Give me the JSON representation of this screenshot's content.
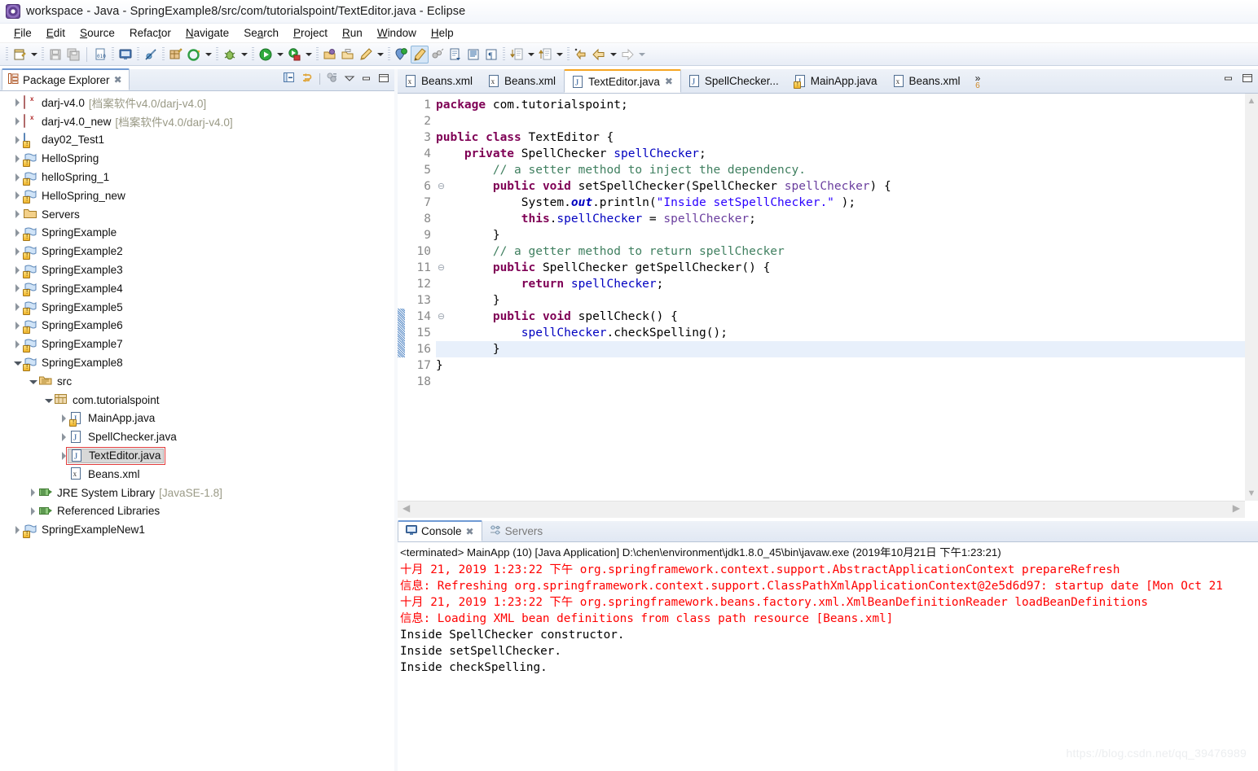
{
  "window": {
    "title": "workspace - Java - SpringExample8/src/com/tutorialspoint/TextEditor.java - Eclipse",
    "app_icon": "eclipse-icon"
  },
  "menubar": [
    {
      "label": "File"
    },
    {
      "label": "Edit"
    },
    {
      "label": "Source"
    },
    {
      "label": "Refactor"
    },
    {
      "label": "Navigate"
    },
    {
      "label": "Search"
    },
    {
      "label": "Project"
    },
    {
      "label": "Run"
    },
    {
      "label": "Window"
    },
    {
      "label": "Help"
    }
  ],
  "toolbar": {
    "items": [
      {
        "name": "new-wizard-icon",
        "kind": "icon"
      },
      {
        "name": "new-wizard-dropdown",
        "kind": "arrow"
      },
      {
        "name": "save-icon",
        "kind": "icon"
      },
      {
        "name": "save-all-icon",
        "kind": "icon"
      },
      {
        "name": "separator",
        "kind": "sep"
      },
      {
        "name": "toggle-hex-icon",
        "kind": "icon"
      },
      {
        "name": "open-console-icon",
        "kind": "icon"
      },
      {
        "name": "skip-breakpoints-icon",
        "kind": "icon"
      },
      {
        "name": "new-java-package-icon",
        "kind": "icon"
      },
      {
        "name": "external-tools-icon",
        "kind": "icon"
      },
      {
        "name": "external-tools-dropdown",
        "kind": "arrow"
      },
      {
        "name": "debug-icon",
        "kind": "icon"
      },
      {
        "name": "debug-dropdown",
        "kind": "arrow"
      },
      {
        "name": "run-icon",
        "kind": "icon"
      },
      {
        "name": "run-dropdown",
        "kind": "arrow"
      },
      {
        "name": "run-as-server-icon",
        "kind": "icon"
      },
      {
        "name": "run-as-server-dropdown",
        "kind": "arrow"
      },
      {
        "name": "open-type-icon",
        "kind": "icon"
      },
      {
        "name": "open-task-icon",
        "kind": "icon"
      },
      {
        "name": "new-annotation-icon",
        "kind": "icon"
      },
      {
        "name": "new-annotation-dropdown",
        "kind": "arrow"
      },
      {
        "name": "search-icon",
        "kind": "icon"
      },
      {
        "name": "mark-occurrences-icon",
        "kind": "icon",
        "selected": true
      },
      {
        "name": "link-icon",
        "kind": "icon"
      },
      {
        "name": "next-edit-icon",
        "kind": "icon"
      },
      {
        "name": "show-whitespace-icon",
        "kind": "icon"
      },
      {
        "name": "pilcrow-icon",
        "kind": "icon"
      },
      {
        "name": "next-annotation-icon",
        "kind": "icon"
      },
      {
        "name": "next-annotation-dropdown",
        "kind": "arrow"
      },
      {
        "name": "previous-annotation-icon",
        "kind": "icon"
      },
      {
        "name": "previous-annotation-dropdown",
        "kind": "arrow"
      },
      {
        "name": "last-edit-location-icon",
        "kind": "icon"
      },
      {
        "name": "back-icon",
        "kind": "icon"
      },
      {
        "name": "back-dropdown",
        "kind": "arrow"
      },
      {
        "name": "forward-icon",
        "kind": "icon"
      },
      {
        "name": "forward-dropdown",
        "kind": "arrow"
      }
    ]
  },
  "package_explorer": {
    "tab_label": "Package Explorer",
    "view_icons": [
      "collapse-all-icon",
      "link-with-editor-icon",
      "view-menu-icon",
      "minimize-icon",
      "maximize-icon"
    ],
    "tree": [
      {
        "label": "darj-v4.0",
        "suffix": "[档案软件v4.0/darj-v4.0]",
        "indent": 0,
        "twisty": "collapsed",
        "icon": "darj-project-icon"
      },
      {
        "label": "darj-v4.0_new",
        "suffix": "[档案软件v4.0/darj-v4.0]",
        "indent": 0,
        "twisty": "collapsed",
        "icon": "darj-project-icon"
      },
      {
        "label": "day02_Test1",
        "suffix": "",
        "indent": 0,
        "twisty": "collapsed",
        "icon": "web-project-icon"
      },
      {
        "label": "HelloSpring",
        "suffix": "",
        "indent": 0,
        "twisty": "collapsed",
        "icon": "java-project-icon"
      },
      {
        "label": "helloSpring_1",
        "suffix": "",
        "indent": 0,
        "twisty": "collapsed",
        "icon": "java-project-icon"
      },
      {
        "label": "HelloSpring_new",
        "suffix": "",
        "indent": 0,
        "twisty": "collapsed",
        "icon": "java-project-icon"
      },
      {
        "label": "Servers",
        "suffix": "",
        "indent": 0,
        "twisty": "collapsed",
        "icon": "folder-icon"
      },
      {
        "label": "SpringExample",
        "suffix": "",
        "indent": 0,
        "twisty": "collapsed",
        "icon": "java-project-icon"
      },
      {
        "label": "SpringExample2",
        "suffix": "",
        "indent": 0,
        "twisty": "collapsed",
        "icon": "java-project-icon"
      },
      {
        "label": "SpringExample3",
        "suffix": "",
        "indent": 0,
        "twisty": "collapsed",
        "icon": "java-project-icon"
      },
      {
        "label": "SpringExample4",
        "suffix": "",
        "indent": 0,
        "twisty": "collapsed",
        "icon": "java-project-icon"
      },
      {
        "label": "SpringExample5",
        "suffix": "",
        "indent": 0,
        "twisty": "collapsed",
        "icon": "java-project-icon"
      },
      {
        "label": "SpringExample6",
        "suffix": "",
        "indent": 0,
        "twisty": "collapsed",
        "icon": "java-project-icon"
      },
      {
        "label": "SpringExample7",
        "suffix": "",
        "indent": 0,
        "twisty": "collapsed",
        "icon": "java-project-icon"
      },
      {
        "label": "SpringExample8",
        "suffix": "",
        "indent": 0,
        "twisty": "expanded",
        "icon": "java-project-icon"
      },
      {
        "label": "src",
        "suffix": "",
        "indent": 1,
        "twisty": "expanded",
        "icon": "source-folder-icon"
      },
      {
        "label": "com.tutorialspoint",
        "suffix": "",
        "indent": 2,
        "twisty": "expanded",
        "icon": "package-icon"
      },
      {
        "label": "MainApp.java",
        "suffix": "",
        "indent": 3,
        "twisty": "collapsed",
        "icon": "java-file-warning-icon"
      },
      {
        "label": "SpellChecker.java",
        "suffix": "",
        "indent": 3,
        "twisty": "collapsed",
        "icon": "java-file-icon"
      },
      {
        "label": "TextEditor.java",
        "suffix": "",
        "indent": 3,
        "twisty": "collapsed",
        "icon": "java-file-icon",
        "selected": true,
        "highlight_box": true
      },
      {
        "label": "Beans.xml",
        "suffix": "",
        "indent": 3,
        "twisty": "none",
        "icon": "xml-file-icon"
      },
      {
        "label": "JRE System Library",
        "suffix": "[JavaSE-1.8]",
        "indent": 1,
        "twisty": "collapsed",
        "icon": "library-icon"
      },
      {
        "label": "Referenced Libraries",
        "suffix": "",
        "indent": 1,
        "twisty": "collapsed",
        "icon": "library-icon"
      },
      {
        "label": "SpringExampleNew1",
        "suffix": "",
        "indent": 0,
        "twisty": "collapsed",
        "icon": "java-project-icon"
      }
    ]
  },
  "editor": {
    "tabs": [
      {
        "label": "Beans.xml",
        "icon": "xml-file-icon",
        "active": false
      },
      {
        "label": "Beans.xml",
        "icon": "xml-file-icon",
        "active": false
      },
      {
        "label": "TextEditor.java",
        "icon": "java-file-icon",
        "active": true,
        "closable": true
      },
      {
        "label": "SpellChecker...",
        "icon": "java-file-icon",
        "active": false
      },
      {
        "label": "MainApp.java",
        "icon": "java-file-warning-icon",
        "active": false
      },
      {
        "label": "Beans.xml",
        "icon": "xml-file-icon",
        "active": false
      }
    ],
    "overflow": {
      "chevron": "»",
      "count": "6"
    },
    "window_buttons": [
      "minimize-icon",
      "maximize-icon"
    ],
    "lines": [
      {
        "n": "1",
        "fold": "",
        "changed": false,
        "highlight": false,
        "tokens": [
          {
            "t": "package ",
            "c": "k"
          },
          {
            "t": "com.tutorialspoint;",
            "c": "pln"
          }
        ]
      },
      {
        "n": "2",
        "fold": "",
        "changed": false,
        "highlight": false,
        "tokens": []
      },
      {
        "n": "3",
        "fold": "",
        "changed": false,
        "highlight": false,
        "tokens": [
          {
            "t": "public class ",
            "c": "k"
          },
          {
            "t": "TextEditor {",
            "c": "pln"
          }
        ]
      },
      {
        "n": "4",
        "fold": "",
        "changed": false,
        "highlight": false,
        "tokens": [
          {
            "t": "    ",
            "c": "pln"
          },
          {
            "t": "private ",
            "c": "k"
          },
          {
            "t": "SpellChecker ",
            "c": "pln"
          },
          {
            "t": "spellChecker",
            "c": "fld"
          },
          {
            "t": ";",
            "c": "pln"
          }
        ]
      },
      {
        "n": "5",
        "fold": "",
        "changed": false,
        "highlight": false,
        "tokens": [
          {
            "t": "        // a setter method to inject the dependency.",
            "c": "cm"
          }
        ]
      },
      {
        "n": "6",
        "fold": "⊖",
        "changed": false,
        "highlight": false,
        "tokens": [
          {
            "t": "        ",
            "c": "pln"
          },
          {
            "t": "public void ",
            "c": "k"
          },
          {
            "t": "setSpellChecker(SpellChecker ",
            "c": "pln"
          },
          {
            "t": "spellChecker",
            "c": "lfd"
          },
          {
            "t": ") {",
            "c": "pln"
          }
        ]
      },
      {
        "n": "7",
        "fold": "",
        "changed": false,
        "highlight": false,
        "tokens": [
          {
            "t": "            System.",
            "c": "pln"
          },
          {
            "t": "out",
            "c": "sf"
          },
          {
            "t": ".println(",
            "c": "pln"
          },
          {
            "t": "\"Inside setSpellChecker.\"",
            "c": "st"
          },
          {
            "t": " );",
            "c": "pln"
          }
        ]
      },
      {
        "n": "8",
        "fold": "",
        "changed": false,
        "highlight": false,
        "tokens": [
          {
            "t": "            ",
            "c": "pln"
          },
          {
            "t": "this",
            "c": "k"
          },
          {
            "t": ".",
            "c": "pln"
          },
          {
            "t": "spellChecker",
            "c": "fld"
          },
          {
            "t": " = ",
            "c": "pln"
          },
          {
            "t": "spellChecker",
            "c": "lfd"
          },
          {
            "t": ";",
            "c": "pln"
          }
        ]
      },
      {
        "n": "9",
        "fold": "",
        "changed": false,
        "highlight": false,
        "tokens": [
          {
            "t": "        }",
            "c": "pln"
          }
        ]
      },
      {
        "n": "10",
        "fold": "",
        "changed": false,
        "highlight": false,
        "tokens": [
          {
            "t": "        // a getter method to return spellChecker",
            "c": "cm"
          }
        ]
      },
      {
        "n": "11",
        "fold": "⊖",
        "changed": false,
        "highlight": false,
        "tokens": [
          {
            "t": "        ",
            "c": "pln"
          },
          {
            "t": "public ",
            "c": "k"
          },
          {
            "t": "SpellChecker getSpellChecker() {",
            "c": "pln"
          }
        ]
      },
      {
        "n": "12",
        "fold": "",
        "changed": false,
        "highlight": false,
        "tokens": [
          {
            "t": "            ",
            "c": "pln"
          },
          {
            "t": "return ",
            "c": "k"
          },
          {
            "t": "spellChecker",
            "c": "fld"
          },
          {
            "t": ";",
            "c": "pln"
          }
        ]
      },
      {
        "n": "13",
        "fold": "",
        "changed": false,
        "highlight": false,
        "tokens": [
          {
            "t": "        }",
            "c": "pln"
          }
        ]
      },
      {
        "n": "14",
        "fold": "⊖",
        "changed": true,
        "highlight": false,
        "tokens": [
          {
            "t": "        ",
            "c": "pln"
          },
          {
            "t": "public void ",
            "c": "k"
          },
          {
            "t": "spellCheck() {",
            "c": "pln"
          }
        ]
      },
      {
        "n": "15",
        "fold": "",
        "changed": true,
        "highlight": false,
        "tokens": [
          {
            "t": "            ",
            "c": "pln"
          },
          {
            "t": "spellChecker",
            "c": "fld"
          },
          {
            "t": ".checkSpelling();",
            "c": "pln"
          }
        ]
      },
      {
        "n": "16",
        "fold": "",
        "changed": true,
        "highlight": true,
        "tokens": [
          {
            "t": "        }",
            "c": "pln"
          }
        ]
      },
      {
        "n": "17",
        "fold": "",
        "changed": false,
        "highlight": false,
        "tokens": [
          {
            "t": "}",
            "c": "pln"
          }
        ]
      },
      {
        "n": "18",
        "fold": "",
        "changed": false,
        "highlight": false,
        "tokens": []
      }
    ]
  },
  "console": {
    "tabs": [
      {
        "label": "Console",
        "icon": "console-icon",
        "active": true,
        "closable": true
      },
      {
        "label": "Servers",
        "icon": "servers-icon",
        "active": false
      }
    ],
    "header": "<terminated> MainApp (10) [Java Application] D:\\chen\\environment\\jdk1.8.0_45\\bin\\javaw.exe (2019年10月21日 下午1:23:21)",
    "lines": [
      {
        "text": "十月 21, 2019 1:23:22 下午 org.springframework.context.support.AbstractApplicationContext prepareRefresh",
        "stream": "err"
      },
      {
        "text": "信息: Refreshing org.springframework.context.support.ClassPathXmlApplicationContext@2e5d6d97: startup date [Mon Oct 21",
        "stream": "err"
      },
      {
        "text": "十月 21, 2019 1:23:22 下午 org.springframework.beans.factory.xml.XmlBeanDefinitionReader loadBeanDefinitions",
        "stream": "err"
      },
      {
        "text": "信息: Loading XML bean definitions from class path resource [Beans.xml]",
        "stream": "err"
      },
      {
        "text": "Inside SpellChecker constructor.",
        "stream": "out"
      },
      {
        "text": "Inside setSpellChecker.",
        "stream": "out"
      },
      {
        "text": "Inside checkSpelling.",
        "stream": "out"
      }
    ]
  },
  "watermark": "https://blog.csdn.net/qq_39476989",
  "colors": {
    "keyword": "#7f0055",
    "comment": "#3f7f5f",
    "string": "#2a00ff",
    "field": "#0000c0",
    "local": "#6a3e9e",
    "console_error": "#ff0000",
    "active_tab_accent": "#f6a623",
    "selection_box": "#e03b3b"
  }
}
